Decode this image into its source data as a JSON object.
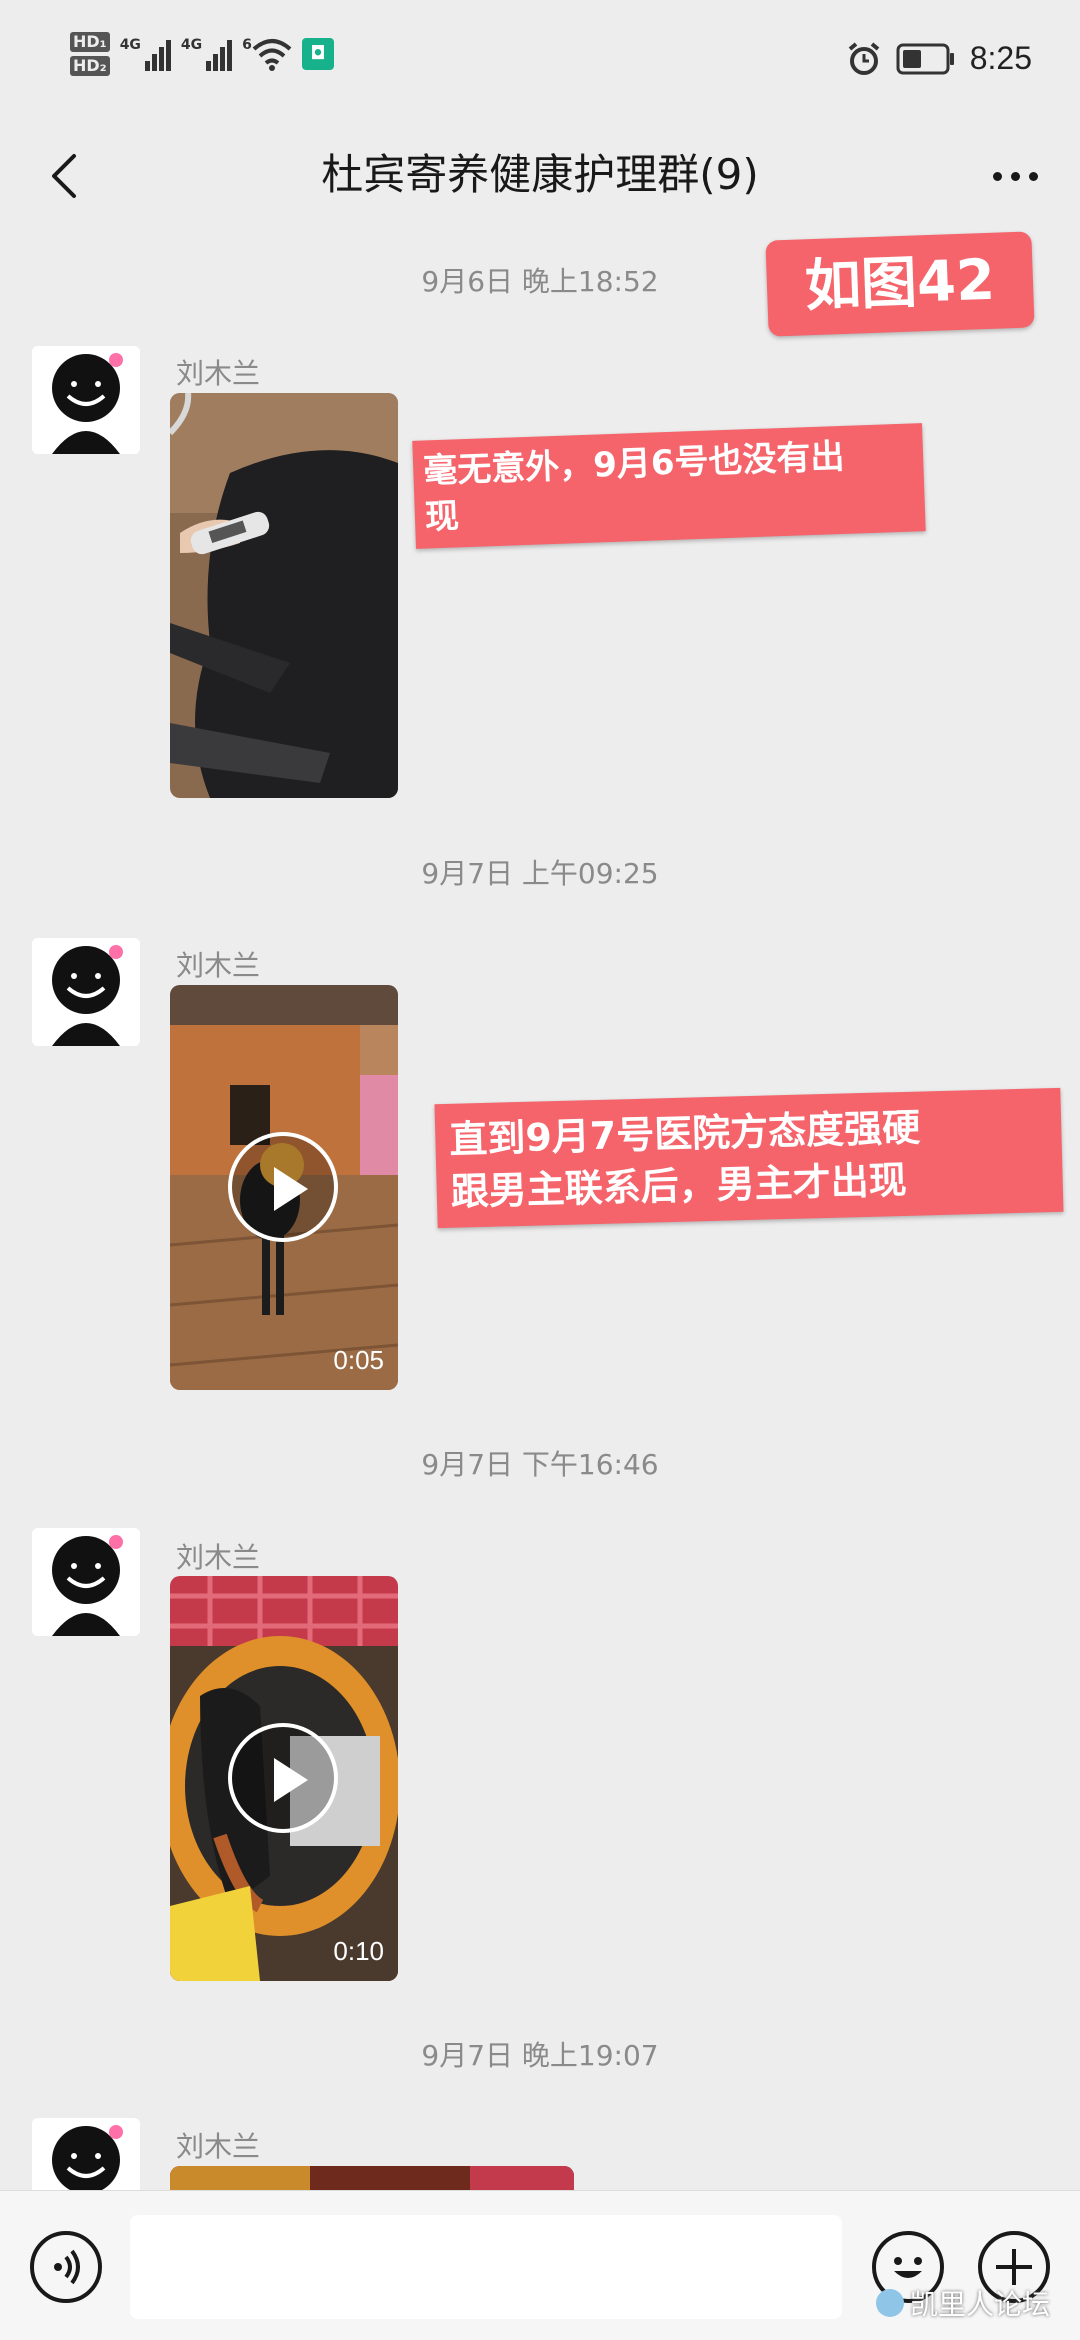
{
  "status_bar": {
    "hd1": "HD₁",
    "hd2": "HD₂",
    "net1": "4G",
    "net2": "4G",
    "wifi_label": "6",
    "app_icon": "mi-icon",
    "time": "8:25",
    "icons": [
      "alarm-icon",
      "battery-icon"
    ]
  },
  "header": {
    "title": "杜宾寄养健康护理群(9)",
    "back_icon": "chevron-left-icon",
    "more_icon": "more-dots-icon"
  },
  "messages": [
    {
      "timestamp": "9月6日 晚上18:52",
      "sender": "刘木兰",
      "type": "image"
    },
    {
      "timestamp": "9月7日 上午09:25",
      "sender": "刘木兰",
      "type": "video",
      "duration": "0:05"
    },
    {
      "timestamp": "9月7日 下午16:46",
      "sender": "刘木兰",
      "type": "video",
      "duration": "0:10"
    },
    {
      "timestamp": "9月7日 晚上19:07",
      "sender": "刘木兰",
      "type": "image"
    }
  ],
  "annotations": {
    "figure_label": "如图42",
    "note1": "毫无意外，9月6号也没有出\n现",
    "note2": "直到9月7号医院方态度强硬\n跟男主联系后，男主才出现",
    "color": "#f5636b"
  },
  "input_bar": {
    "voice_icon": "voice-icon",
    "emoji_icon": "emoji-icon",
    "plus_icon": "plus-icon",
    "watermark": "凯里人论坛"
  }
}
